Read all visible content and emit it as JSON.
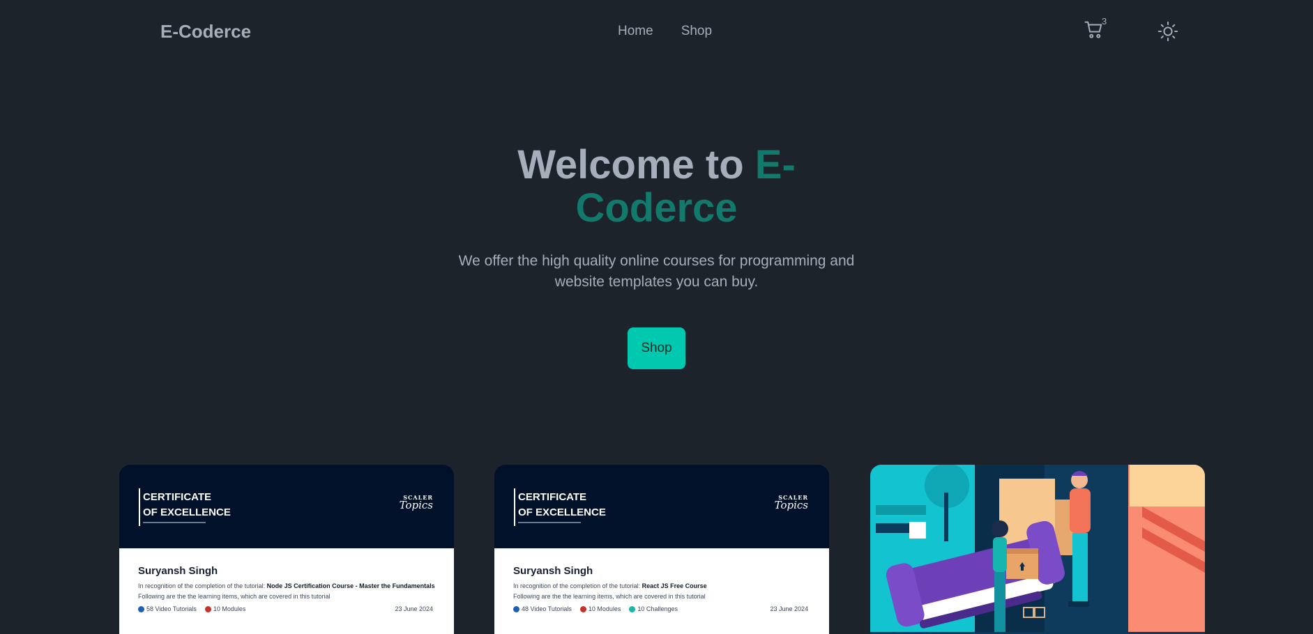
{
  "navbar": {
    "brand": "E-Coderce",
    "links": [
      {
        "label": "Home"
      },
      {
        "label": "Shop"
      }
    ],
    "cart_count": "3",
    "cart_icon": "cart-icon",
    "theme_icon": "sun-icon"
  },
  "hero": {
    "title_prefix": "Welcome to ",
    "title_accent": "E-Coderce",
    "subtitle": "We offer the high quality online courses for programming and website templates you can buy.",
    "button_label": "Shop",
    "accent_color": "#117a6c",
    "button_color": "#00c9b0"
  },
  "cards": [
    {
      "cert_title_line1": "CERTIFICATE",
      "cert_title_line2": "OF EXCELLENCE",
      "logo_top": "SCALER",
      "logo_bottom": "Topics",
      "name": "Suryansh Singh",
      "recognition_prefix": "In recognition of the completion of the tutorial: ",
      "course": "Node JS Certification Course - Master the Fundamentals",
      "following": "Following are the the learning items, which are covered in this tutorial",
      "stats": [
        "58 Video Tutorials",
        "10 Modules"
      ],
      "date": "23 June 2024"
    },
    {
      "cert_title_line1": "CERTIFICATE",
      "cert_title_line2": "OF EXCELLENCE",
      "logo_top": "SCALER",
      "logo_bottom": "Topics",
      "name": "Suryansh Singh",
      "recognition_prefix": "In recognition of the completion of the tutorial: ",
      "course": "React JS Free Course",
      "following": "Following are the the learning items, which are covered in this tutorial",
      "stats": [
        "48 Video Tutorials",
        "10 Modules",
        "10 Challenges"
      ],
      "date": "23 June 2024"
    }
  ],
  "background_color": "#1d232a"
}
